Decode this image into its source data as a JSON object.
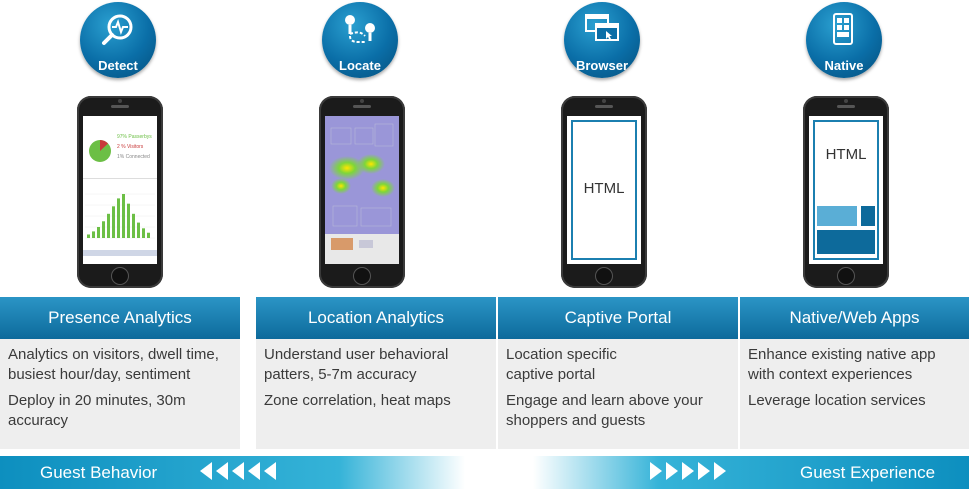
{
  "columns": [
    {
      "badge": "Detect",
      "icon": "magnifier-pulse-icon",
      "screen": {
        "legend": [
          "97% Passerbys",
          "2 % Visitors",
          "1% Connected"
        ],
        "bar_heights": [
          0.08,
          0.15,
          0.25,
          0.38,
          0.55,
          0.72,
          0.9,
          1.0,
          0.78,
          0.55,
          0.35,
          0.22,
          0.12
        ]
      },
      "title": "Presence Analytics",
      "lines": [
        "Analytics on visitors, dwell time, busiest hour/day, sentiment",
        "Deploy in 20 minutes, 30m accuracy"
      ]
    },
    {
      "badge": "Locate",
      "icon": "location-pins-icon",
      "title": "Location Analytics",
      "lines": [
        "Understand user behavioral patters, 5-7m accuracy",
        "Zone correlation, heat maps"
      ]
    },
    {
      "badge": "Browser",
      "icon": "browser-windows-icon",
      "screen_text": "HTML",
      "title": "Captive Portal",
      "lines": [
        "Location specific captive portal",
        "Engage and learn above your shoppers and guests"
      ]
    },
    {
      "badge": "Native",
      "icon": "mobile-app-icon",
      "screen_text": "HTML",
      "title": "Native/Web Apps",
      "lines": [
        "Enhance existing native app with context experiences",
        "Leverage location services"
      ]
    }
  ],
  "footer": {
    "left_label": "Guest Behavior",
    "right_label": "Guest Experience"
  },
  "colors": {
    "accent": "#0d6a9b",
    "header_top": "#2b95c6",
    "panel_bg": "#eeeeee"
  }
}
